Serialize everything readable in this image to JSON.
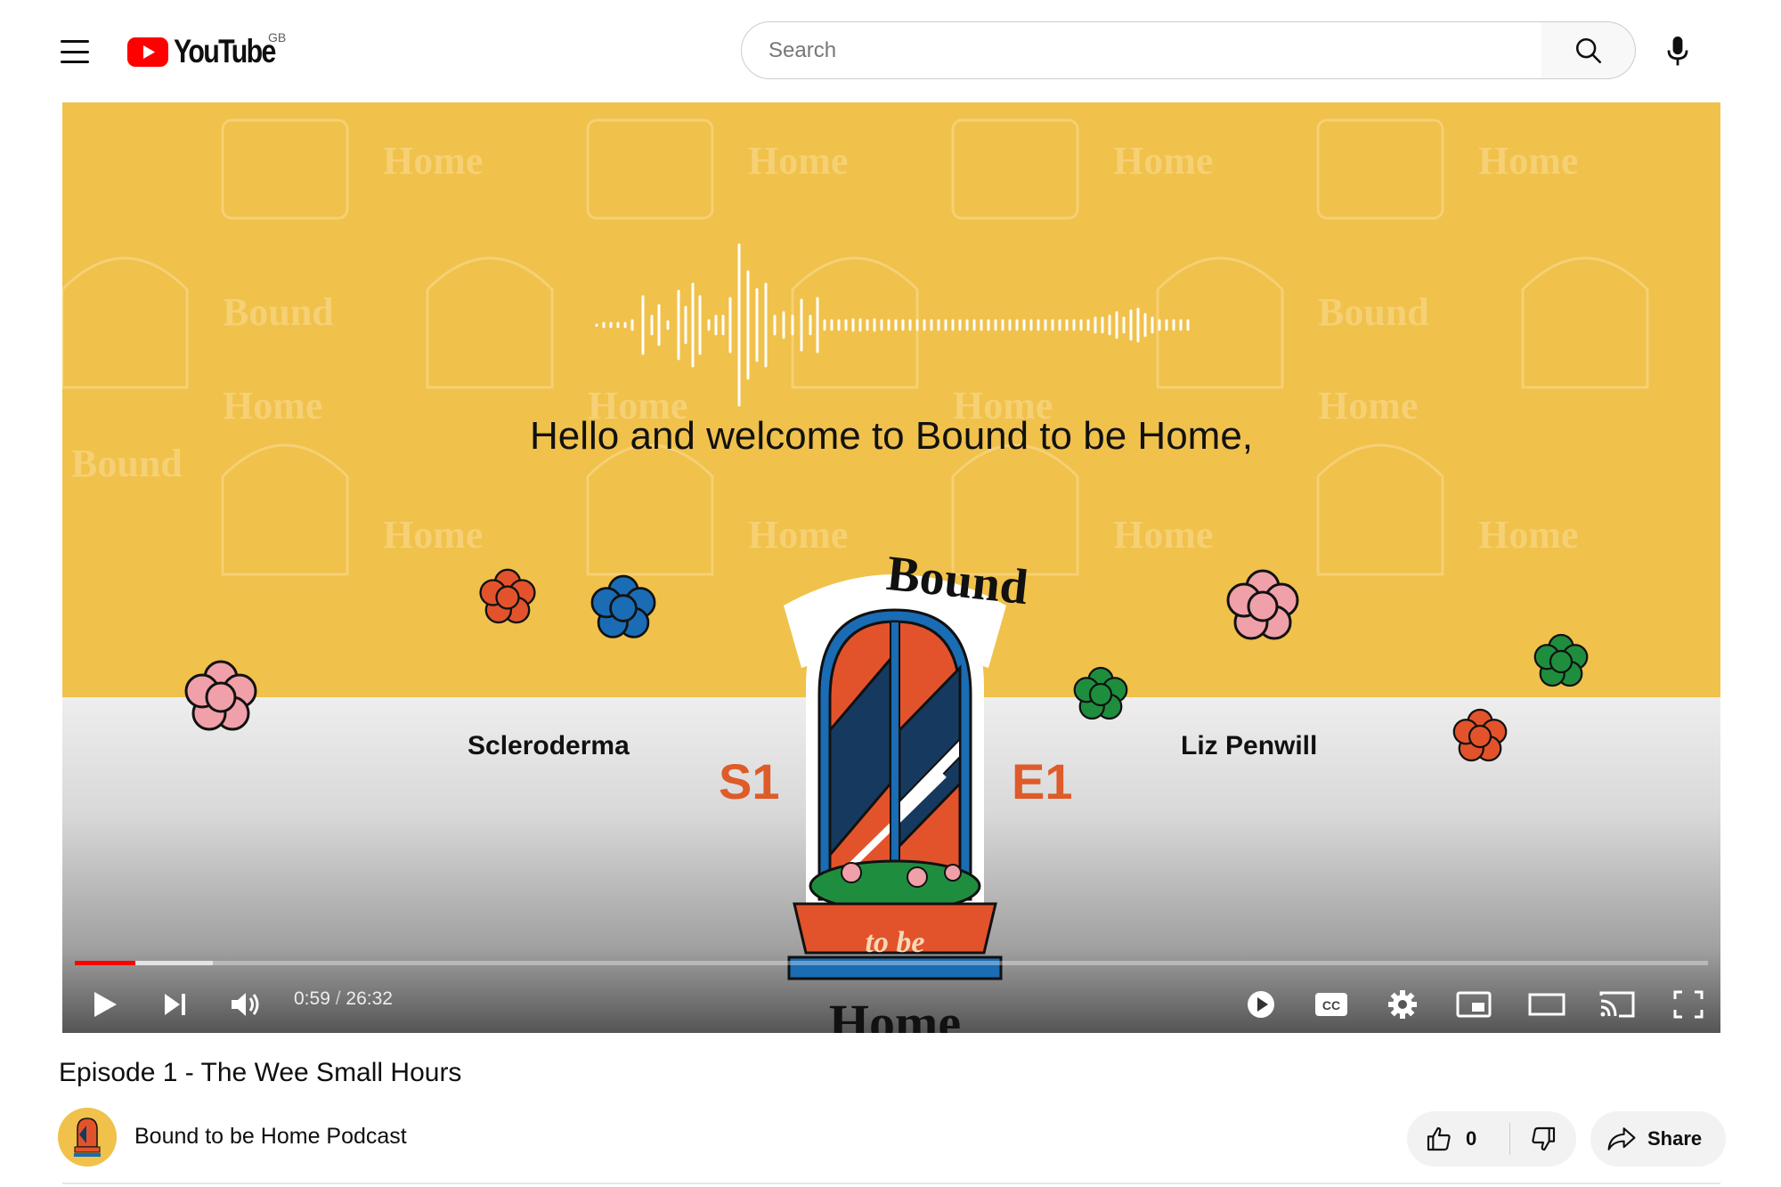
{
  "header": {
    "logo_text": "YouTube",
    "region": "GB",
    "search_placeholder": "Search"
  },
  "player": {
    "caption": "Hello and welcome to Bound to be Home,",
    "topic": "Scleroderma",
    "speaker": "Liz Penwill",
    "season": "S1",
    "episode": "E1",
    "logo_top": "Bound",
    "logo_mid": "to be",
    "logo_bottom": "Home",
    "time_current": "0:59",
    "time_separator": " / ",
    "time_total": "26:32",
    "progress_fraction": 0.037
  },
  "video": {
    "title": "Episode 1 - The Wee Small Hours",
    "channel_name": "Bound to be Home Podcast",
    "like_count": "0",
    "share_label": "Share"
  },
  "colors": {
    "brand_red": "#ff0000",
    "background_yellow": "#f0c14b",
    "accent_orange": "#de5b2a"
  }
}
